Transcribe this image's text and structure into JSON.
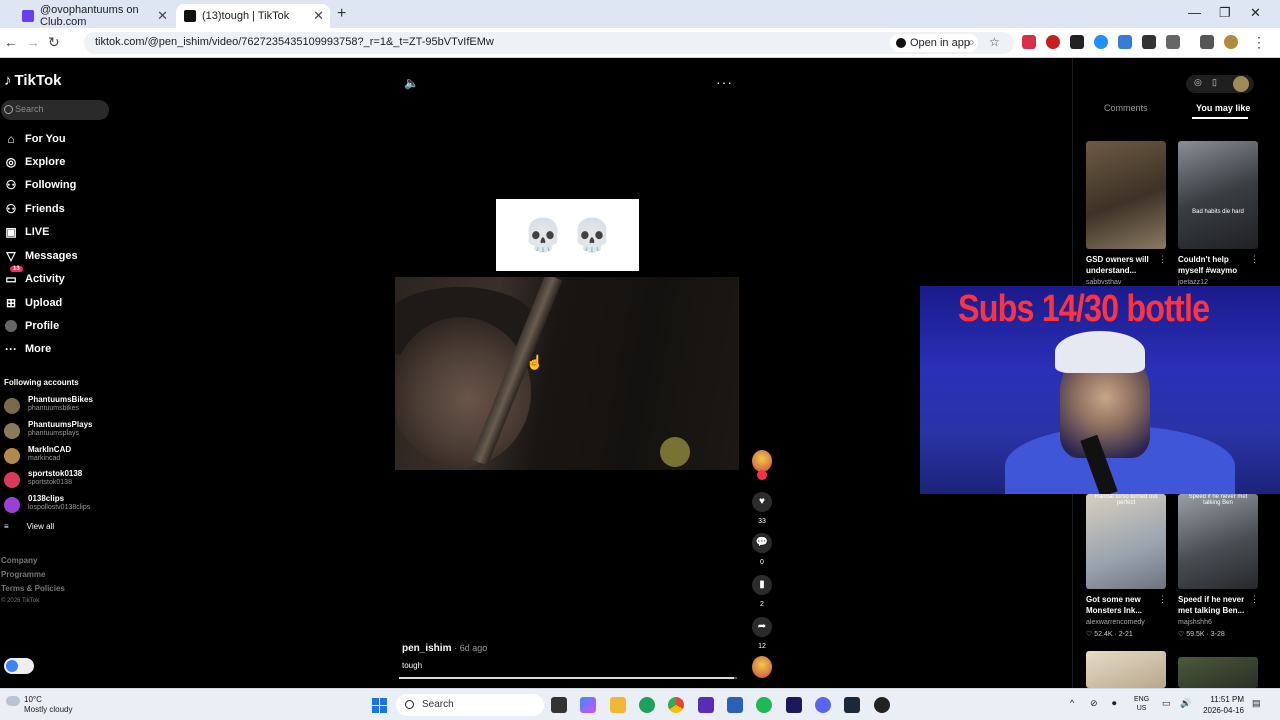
{
  "browser": {
    "tabs": [
      {
        "title": "@ovophantuums on Club.com",
        "active": false
      },
      {
        "title": "(13)tough | TikTok",
        "active": true
      }
    ],
    "url": "tiktok.com/@pen_ishim/video/7627235435109993758?_r=1&_t=ZT-95bVTvIfEMw",
    "open_in_app": "Open in app"
  },
  "sidebar": {
    "logo": "TikTok",
    "search_placeholder": "Search",
    "nav": [
      {
        "label": "For You",
        "icon": "home-icon"
      },
      {
        "label": "Explore",
        "icon": "compass-icon"
      },
      {
        "label": "Following",
        "icon": "following-icon"
      },
      {
        "label": "Friends",
        "icon": "friends-icon"
      },
      {
        "label": "LIVE",
        "icon": "live-icon"
      },
      {
        "label": "Messages",
        "icon": "messages-icon"
      },
      {
        "label": "Activity",
        "icon": "activity-icon",
        "badge": "13"
      },
      {
        "label": "Upload",
        "icon": "upload-icon"
      },
      {
        "label": "Profile",
        "icon": "profile-icon"
      },
      {
        "label": "More",
        "icon": "more-icon"
      }
    ],
    "following_title": "Following accounts",
    "accounts": [
      {
        "name": "PhantuumsBikes",
        "handle": "phantuumsbikes"
      },
      {
        "name": "PhantuumsPlays",
        "handle": "phantuumsplays"
      },
      {
        "name": "MarkInCAD",
        "handle": "markincad"
      },
      {
        "name": "sportstok0138",
        "handle": "sportstok0138"
      },
      {
        "name": "0138clips",
        "handle": "lospollostv0138clips"
      }
    ],
    "view_all": "View all",
    "footer": [
      "Company",
      "Programme",
      "Terms & Policies"
    ],
    "copyright": "© 2026 TikTok"
  },
  "video": {
    "overlay_emoji": "💀 💀",
    "author": "pen_ishim",
    "time_ago": "· 6d ago",
    "caption": "tough",
    "progress": 0.99,
    "likes": "33",
    "comments": "0",
    "saves": "2",
    "shares": "12"
  },
  "right_panel": {
    "tabs": [
      "Comments",
      "You may like"
    ],
    "active_tab": "You may like",
    "cards": [
      {
        "title": "GSD owners will understand...",
        "author": "sabbvsthav",
        "meta": "",
        "overlay": "",
        "top": ""
      },
      {
        "title": "Couldn't help myself #waymo",
        "author": "joetazz12",
        "meta": "",
        "overlay": "Bad habits die hard",
        "top": ""
      },
      {
        "title": "Got some new Monsters Ink...",
        "author": "alexwarrencomedy",
        "meta": "♡ 52.4K · 2-21",
        "overlay": "",
        "top": "Randal torso turned out perfect"
      },
      {
        "title": "Speed if he never met talking Ben...",
        "author": "majshshh6",
        "meta": "♡ 59.5K · 3-28",
        "overlay": "",
        "top": "Speed if he never met talking Ben"
      }
    ]
  },
  "webcam": {
    "overlay_text": "Subs 14/30 bottle"
  },
  "taskbar": {
    "temperature": "10°C",
    "weather": "Mostly cloudy",
    "search": "Search",
    "lang_top": "ENG",
    "lang_bottom": "US",
    "time": "11:51 PM",
    "date": "2026-04-16"
  },
  "colors": {
    "accent": "#fe2c55",
    "webcam_text": "#ff3340"
  }
}
